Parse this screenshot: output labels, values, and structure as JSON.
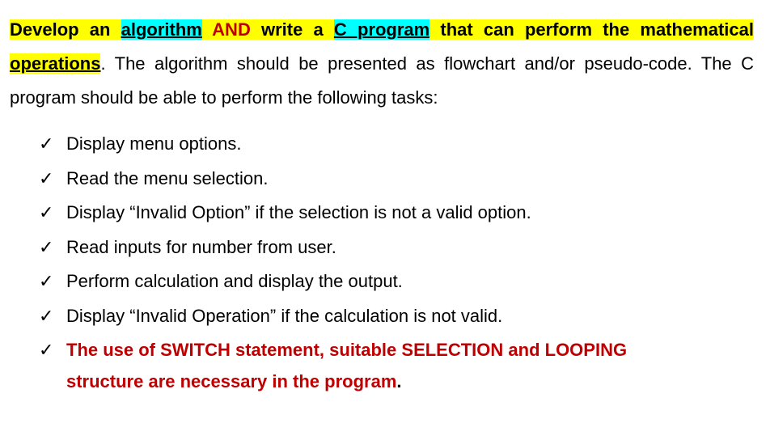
{
  "intro": {
    "develop_an": "Develop an ",
    "algorithm": "algorithm",
    "and": " AND ",
    "write_a": "write a ",
    "c_program": "C program",
    "perform_math": " that can perform the mathematical ",
    "operations": "operations",
    "period_the": ". The  algorithm should be presented as flowchart and/or pseudo-code. The C program should be able to perform the following tasks:"
  },
  "items": {
    "i1": "Display menu options.",
    "i2": "Read the menu selection.",
    "i3": "Display “Invalid Option” if the selection is not a valid option.",
    "i4": "Read inputs for number from user.",
    "i5": "Perform calculation and display the output.",
    "i6": "Display “Invalid Operation” if the calculation is not valid.",
    "i7a": "The use of SWITCH statement, suitable SELECTION and LOOPING ",
    "i7b": "structure are necessary in the program",
    "i7c": "."
  }
}
